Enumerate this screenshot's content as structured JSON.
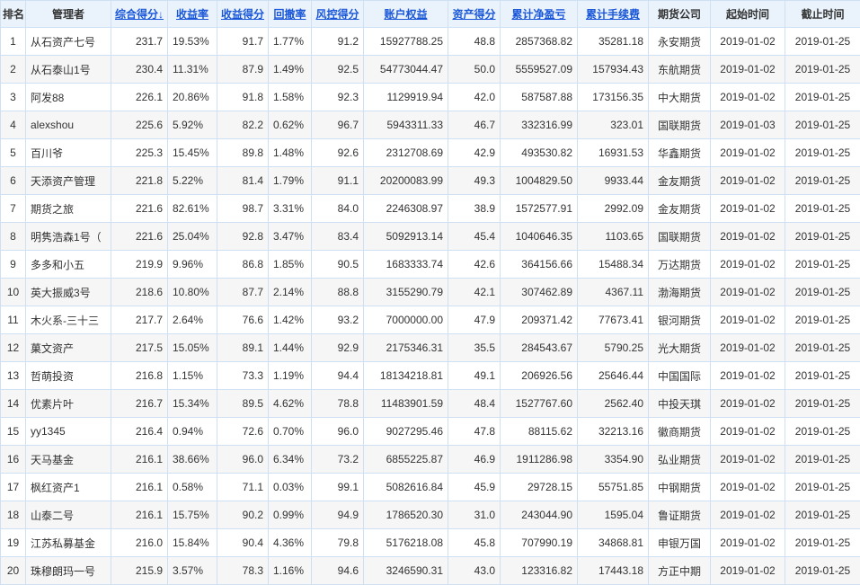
{
  "headers": {
    "rank": "排名",
    "manager": "管理者",
    "score": "综合得分↓",
    "return": "收益率",
    "return_score": "收益得分",
    "drawdown": "回撤率",
    "risk_score": "风控得分",
    "equity": "账户权益",
    "asset_score": "资产得分",
    "net_profit": "累计净盈亏",
    "fees": "累计手续费",
    "company": "期货公司",
    "start": "起始时间",
    "end": "截止时间"
  },
  "colors": {
    "header_bg": "#eaf3fc",
    "link": "#1a57d8",
    "profit_red": "#e2282e",
    "border": "#cfe0f2"
  },
  "rows": [
    {
      "rank": "1",
      "manager": "从石资产七号",
      "score": "231.7",
      "return": "19.53%",
      "return_score": "91.7",
      "drawdown": "1.77%",
      "risk_score": "91.2",
      "equity": "15927788.25",
      "asset_score": "48.8",
      "net_profit": "2857368.82",
      "fees": "35281.18",
      "company": "永安期货",
      "start": "2019-01-02",
      "end": "2019-01-25"
    },
    {
      "rank": "2",
      "manager": "从石泰山1号",
      "score": "230.4",
      "return": "11.31%",
      "return_score": "87.9",
      "drawdown": "1.49%",
      "risk_score": "92.5",
      "equity": "54773044.47",
      "asset_score": "50.0",
      "net_profit": "5559527.09",
      "fees": "157934.43",
      "company": "东航期货",
      "start": "2019-01-02",
      "end": "2019-01-25"
    },
    {
      "rank": "3",
      "manager": "阿发88",
      "score": "226.1",
      "return": "20.86%",
      "return_score": "91.8",
      "drawdown": "1.58%",
      "risk_score": "92.3",
      "equity": "1129919.94",
      "asset_score": "42.0",
      "net_profit": "587587.88",
      "fees": "173156.35",
      "company": "中大期货",
      "start": "2019-01-02",
      "end": "2019-01-25"
    },
    {
      "rank": "4",
      "manager": "alexshou",
      "score": "225.6",
      "return": "5.92%",
      "return_score": "82.2",
      "drawdown": "0.62%",
      "risk_score": "96.7",
      "equity": "5943311.33",
      "asset_score": "46.7",
      "net_profit": "332316.99",
      "fees": "323.01",
      "company": "国联期货",
      "start": "2019-01-03",
      "end": "2019-01-25"
    },
    {
      "rank": "5",
      "manager": "百川爷",
      "score": "225.3",
      "return": "15.45%",
      "return_score": "89.8",
      "drawdown": "1.48%",
      "risk_score": "92.6",
      "equity": "2312708.69",
      "asset_score": "42.9",
      "net_profit": "493530.82",
      "fees": "16931.53",
      "company": "华鑫期货",
      "start": "2019-01-02",
      "end": "2019-01-25"
    },
    {
      "rank": "6",
      "manager": "天添资产管理",
      "score": "221.8",
      "return": "5.22%",
      "return_score": "81.4",
      "drawdown": "1.79%",
      "risk_score": "91.1",
      "equity": "20200083.99",
      "asset_score": "49.3",
      "net_profit": "1004829.50",
      "fees": "9933.44",
      "company": "金友期货",
      "start": "2019-01-02",
      "end": "2019-01-25"
    },
    {
      "rank": "7",
      "manager": "期货之旅",
      "score": "221.6",
      "return": "82.61%",
      "return_score": "98.7",
      "drawdown": "3.31%",
      "risk_score": "84.0",
      "equity": "2246308.97",
      "asset_score": "38.9",
      "net_profit": "1572577.91",
      "fees": "2992.09",
      "company": "金友期货",
      "start": "2019-01-02",
      "end": "2019-01-25"
    },
    {
      "rank": "8",
      "manager": "明隽浩森1号（",
      "score": "221.6",
      "return": "25.04%",
      "return_score": "92.8",
      "drawdown": "3.47%",
      "risk_score": "83.4",
      "equity": "5092913.14",
      "asset_score": "45.4",
      "net_profit": "1040646.35",
      "fees": "1103.65",
      "company": "国联期货",
      "start": "2019-01-02",
      "end": "2019-01-25"
    },
    {
      "rank": "9",
      "manager": "多多和小五",
      "score": "219.9",
      "return": "9.96%",
      "return_score": "86.8",
      "drawdown": "1.85%",
      "risk_score": "90.5",
      "equity": "1683333.74",
      "asset_score": "42.6",
      "net_profit": "364156.66",
      "fees": "15488.34",
      "company": "万达期货",
      "start": "2019-01-02",
      "end": "2019-01-25"
    },
    {
      "rank": "10",
      "manager": "英大振威3号",
      "score": "218.6",
      "return": "10.80%",
      "return_score": "87.7",
      "drawdown": "2.14%",
      "risk_score": "88.8",
      "equity": "3155290.79",
      "asset_score": "42.1",
      "net_profit": "307462.89",
      "fees": "4367.11",
      "company": "渤海期货",
      "start": "2019-01-02",
      "end": "2019-01-25"
    },
    {
      "rank": "11",
      "manager": "木火系-三十三",
      "score": "217.7",
      "return": "2.64%",
      "return_score": "76.6",
      "drawdown": "1.42%",
      "risk_score": "93.2",
      "equity": "7000000.00",
      "asset_score": "47.9",
      "net_profit": "209371.42",
      "fees": "77673.41",
      "company": "银河期货",
      "start": "2019-01-02",
      "end": "2019-01-25"
    },
    {
      "rank": "12",
      "manager": "菓文资产",
      "score": "217.5",
      "return": "15.05%",
      "return_score": "89.1",
      "drawdown": "1.44%",
      "risk_score": "92.9",
      "equity": "2175346.31",
      "asset_score": "35.5",
      "net_profit": "284543.67",
      "fees": "5790.25",
      "company": "光大期货",
      "start": "2019-01-02",
      "end": "2019-01-25"
    },
    {
      "rank": "13",
      "manager": "哲萌投资",
      "score": "216.8",
      "return": "1.15%",
      "return_score": "73.3",
      "drawdown": "1.19%",
      "risk_score": "94.4",
      "equity": "18134218.81",
      "asset_score": "49.1",
      "net_profit": "206926.56",
      "fees": "25646.44",
      "company": "中国国际",
      "start": "2019-01-02",
      "end": "2019-01-25"
    },
    {
      "rank": "14",
      "manager": "优素片叶",
      "score": "216.7",
      "return": "15.34%",
      "return_score": "89.5",
      "drawdown": "4.62%",
      "risk_score": "78.8",
      "equity": "11483901.59",
      "asset_score": "48.4",
      "net_profit": "1527767.60",
      "fees": "2562.40",
      "company": "中投天琪",
      "start": "2019-01-02",
      "end": "2019-01-25"
    },
    {
      "rank": "15",
      "manager": "yy1345",
      "score": "216.4",
      "return": "0.94%",
      "return_score": "72.6",
      "drawdown": "0.70%",
      "risk_score": "96.0",
      "equity": "9027295.46",
      "asset_score": "47.8",
      "net_profit": "88115.62",
      "fees": "32213.16",
      "company": "徽商期货",
      "start": "2019-01-02",
      "end": "2019-01-25"
    },
    {
      "rank": "16",
      "manager": "天马基金",
      "score": "216.1",
      "return": "38.66%",
      "return_score": "96.0",
      "drawdown": "6.34%",
      "risk_score": "73.2",
      "equity": "6855225.87",
      "asset_score": "46.9",
      "net_profit": "1911286.98",
      "fees": "3354.90",
      "company": "弘业期货",
      "start": "2019-01-02",
      "end": "2019-01-25"
    },
    {
      "rank": "17",
      "manager": "枫红资产1",
      "score": "216.1",
      "return": "0.58%",
      "return_score": "71.1",
      "drawdown": "0.03%",
      "risk_score": "99.1",
      "equity": "5082616.84",
      "asset_score": "45.9",
      "net_profit": "29728.15",
      "fees": "55751.85",
      "company": "中钢期货",
      "start": "2019-01-02",
      "end": "2019-01-25"
    },
    {
      "rank": "18",
      "manager": "山泰二号",
      "score": "216.1",
      "return": "15.75%",
      "return_score": "90.2",
      "drawdown": "0.99%",
      "risk_score": "94.9",
      "equity": "1786520.30",
      "asset_score": "31.0",
      "net_profit": "243044.90",
      "fees": "1595.04",
      "company": "鲁证期货",
      "start": "2019-01-02",
      "end": "2019-01-25"
    },
    {
      "rank": "19",
      "manager": "江苏私募基金",
      "score": "216.0",
      "return": "15.84%",
      "return_score": "90.4",
      "drawdown": "4.36%",
      "risk_score": "79.8",
      "equity": "5176218.08",
      "asset_score": "45.8",
      "net_profit": "707990.19",
      "fees": "34868.81",
      "company": "申银万国",
      "start": "2019-01-02",
      "end": "2019-01-25"
    },
    {
      "rank": "20",
      "manager": "珠穆朗玛一号",
      "score": "215.9",
      "return": "3.57%",
      "return_score": "78.3",
      "drawdown": "1.16%",
      "risk_score": "94.6",
      "equity": "3246590.31",
      "asset_score": "43.0",
      "net_profit": "123316.82",
      "fees": "17443.18",
      "company": "方正中期",
      "start": "2019-01-02",
      "end": "2019-01-25"
    }
  ]
}
